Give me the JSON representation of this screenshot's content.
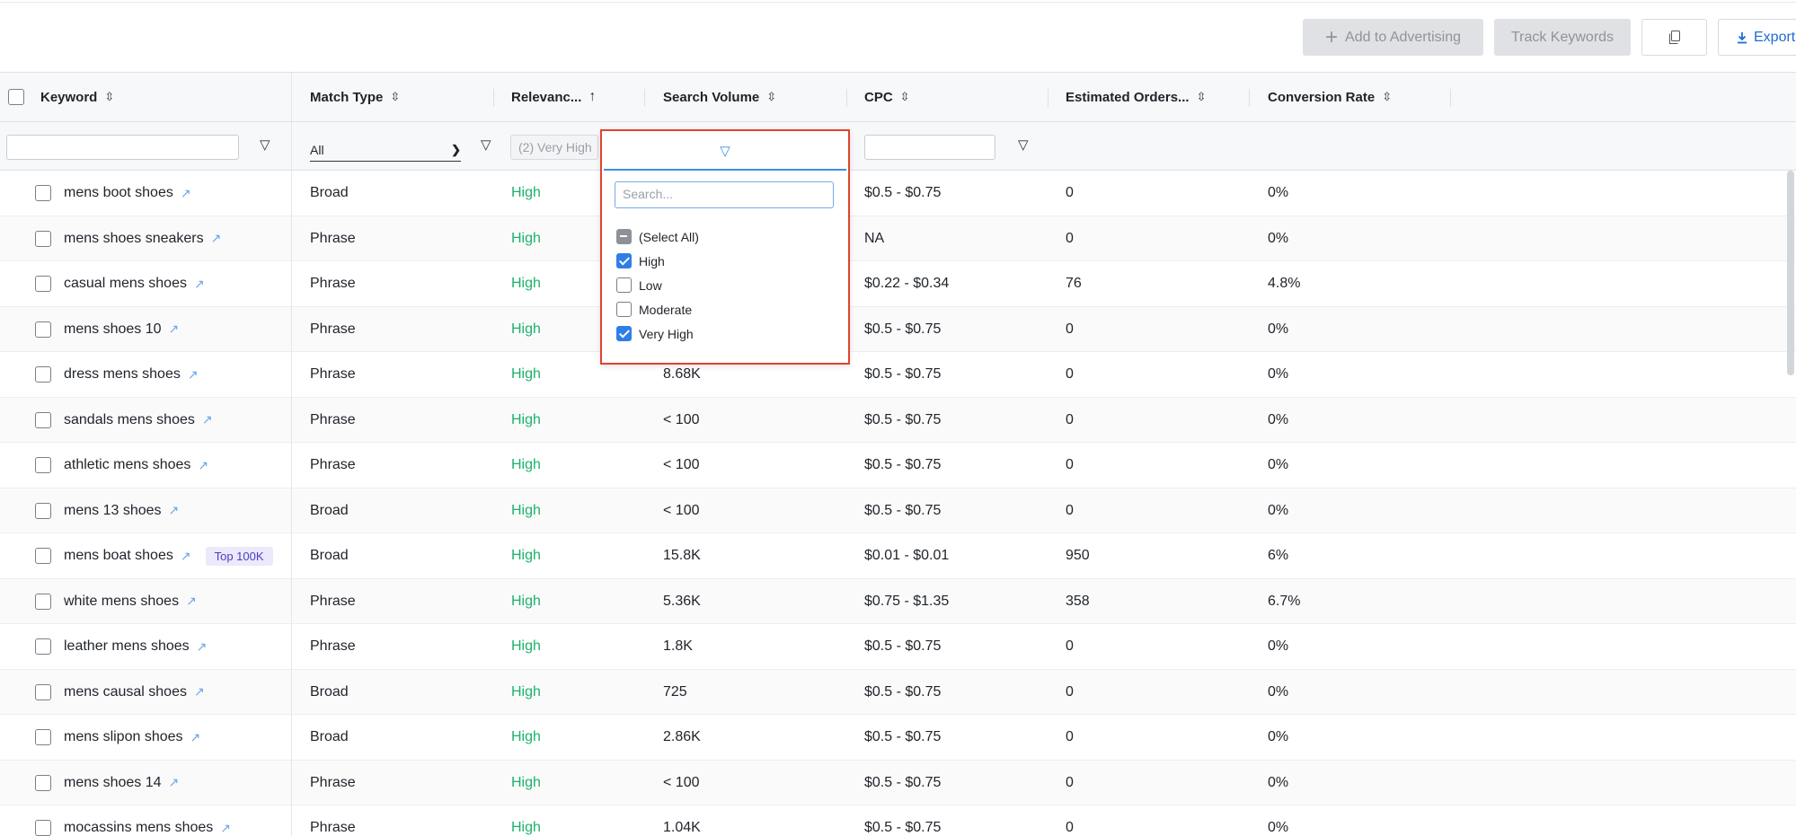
{
  "toolbar": {
    "add_label": "Add to Advertising",
    "track_label": "Track Keywords",
    "export_label": "Export"
  },
  "columns": {
    "keyword": "Keyword",
    "match_type": "Match Type",
    "relevance": "Relevanc...",
    "search_volume": "Search Volume",
    "cpc": "CPC",
    "estimated_orders": "Estimated Orders...",
    "conversion_rate": "Conversion Rate"
  },
  "filters": {
    "match_type_value": "All",
    "relevance_value": "(2) Very High"
  },
  "relevance_popup": {
    "search_placeholder": "Search...",
    "options": [
      {
        "label": "(Select All)",
        "state": "partial"
      },
      {
        "label": "High",
        "state": "checked"
      },
      {
        "label": "Low",
        "state": "unchecked"
      },
      {
        "label": "Moderate",
        "state": "unchecked"
      },
      {
        "label": "Very High",
        "state": "checked"
      }
    ]
  },
  "rows": [
    {
      "keyword": "mens boot shoes",
      "badge": "",
      "match": "Broad",
      "relevance": "High",
      "volume": "",
      "cpc": "$0.5 - $0.75",
      "orders": "0",
      "conversion": "0%"
    },
    {
      "keyword": "mens shoes sneakers",
      "badge": "",
      "match": "Phrase",
      "relevance": "High",
      "volume": "",
      "cpc": "NA",
      "orders": "0",
      "conversion": "0%"
    },
    {
      "keyword": "casual mens shoes",
      "badge": "",
      "match": "Phrase",
      "relevance": "High",
      "volume": "",
      "cpc": "$0.22 - $0.34",
      "orders": "76",
      "conversion": "4.8%"
    },
    {
      "keyword": "mens shoes 10",
      "badge": "",
      "match": "Phrase",
      "relevance": "High",
      "volume": "",
      "cpc": "$0.5 - $0.75",
      "orders": "0",
      "conversion": "0%"
    },
    {
      "keyword": "dress mens shoes",
      "badge": "",
      "match": "Phrase",
      "relevance": "High",
      "volume": "8.68K",
      "cpc": "$0.5 - $0.75",
      "orders": "0",
      "conversion": "0%"
    },
    {
      "keyword": "sandals mens shoes",
      "badge": "",
      "match": "Phrase",
      "relevance": "High",
      "volume": "< 100",
      "cpc": "$0.5 - $0.75",
      "orders": "0",
      "conversion": "0%"
    },
    {
      "keyword": "athletic mens shoes",
      "badge": "",
      "match": "Phrase",
      "relevance": "High",
      "volume": "< 100",
      "cpc": "$0.5 - $0.75",
      "orders": "0",
      "conversion": "0%"
    },
    {
      "keyword": "mens 13 shoes",
      "badge": "",
      "match": "Broad",
      "relevance": "High",
      "volume": "< 100",
      "cpc": "$0.5 - $0.75",
      "orders": "0",
      "conversion": "0%"
    },
    {
      "keyword": "mens boat shoes",
      "badge": "Top 100K",
      "match": "Broad",
      "relevance": "High",
      "volume": "15.8K",
      "cpc": "$0.01 - $0.01",
      "orders": "950",
      "conversion": "6%"
    },
    {
      "keyword": "white mens shoes",
      "badge": "",
      "match": "Phrase",
      "relevance": "High",
      "volume": "5.36K",
      "cpc": "$0.75 - $1.35",
      "orders": "358",
      "conversion": "6.7%"
    },
    {
      "keyword": "leather mens shoes",
      "badge": "",
      "match": "Phrase",
      "relevance": "High",
      "volume": "1.8K",
      "cpc": "$0.5 - $0.75",
      "orders": "0",
      "conversion": "0%"
    },
    {
      "keyword": "mens causal shoes",
      "badge": "",
      "match": "Broad",
      "relevance": "High",
      "volume": "725",
      "cpc": "$0.5 - $0.75",
      "orders": "0",
      "conversion": "0%"
    },
    {
      "keyword": "mens slipon shoes",
      "badge": "",
      "match": "Broad",
      "relevance": "High",
      "volume": "2.86K",
      "cpc": "$0.5 - $0.75",
      "orders": "0",
      "conversion": "0%"
    },
    {
      "keyword": "mens shoes 14",
      "badge": "",
      "match": "Phrase",
      "relevance": "High",
      "volume": "< 100",
      "cpc": "$0.5 - $0.75",
      "orders": "0",
      "conversion": "0%"
    },
    {
      "keyword": "mocassins mens shoes",
      "badge": "",
      "match": "Phrase",
      "relevance": "High",
      "volume": "1.04K",
      "cpc": "$0.5 - $0.75",
      "orders": "0",
      "conversion": "0%"
    }
  ]
}
